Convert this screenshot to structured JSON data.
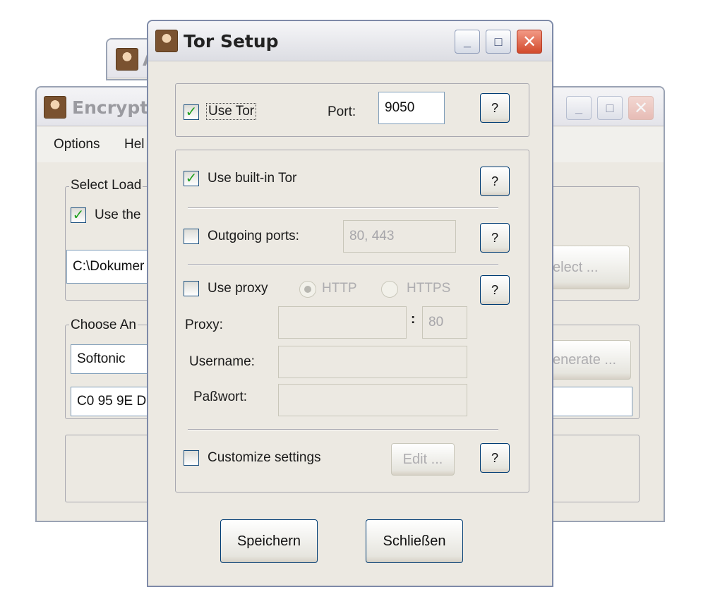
{
  "back_window_2": {
    "title_partial": "A"
  },
  "encryption_window": {
    "title_partial": "Encryptio",
    "menu": {
      "options": "Options",
      "help_partial": "Hel"
    },
    "group1_label_partial": "Select Load",
    "checkbox_label_partial": "Use the",
    "path_value_partial": "C:\\Dokumer",
    "select_button_partial": "elect ...",
    "group2_label_partial": "Choose An",
    "name_value": "Softonic",
    "key_value_partial": "C0 95 9E D",
    "generate_button_partial": "enerate ..."
  },
  "tor_setup": {
    "title": "Tor Setup",
    "use_tor": {
      "label": "Use Tor",
      "checked": true
    },
    "port_label": "Port:",
    "port_value": "9050",
    "help_label": "?",
    "use_builtin": {
      "label": "Use built-in Tor",
      "checked": true
    },
    "outgoing_ports": {
      "label": "Outgoing ports:",
      "value": "80, 443",
      "checked": false
    },
    "use_proxy": {
      "label": "Use proxy",
      "checked": false
    },
    "proxy_types": [
      "HTTP",
      "HTTPS"
    ],
    "proxy_label": "Proxy:",
    "proxy_value": "",
    "proxy_port_sep": ":",
    "proxy_port_value": "80",
    "username_label": "Username:",
    "username_value": "",
    "password_label": "Paßwort:",
    "password_value": "",
    "customize": {
      "label": "Customize settings",
      "checked": false
    },
    "edit_button": "Edit ...",
    "save_button": "Speichern",
    "close_button": "Schließen"
  },
  "window_controls": {
    "minimize": "_",
    "maximize": "□",
    "close": "✕"
  }
}
